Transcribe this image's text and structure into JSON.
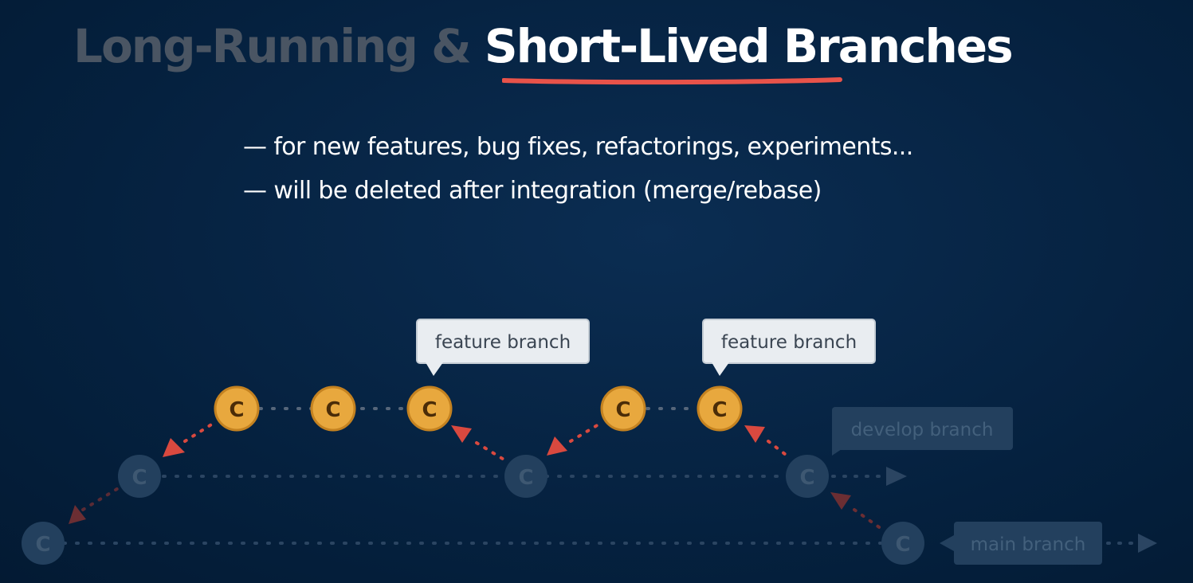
{
  "title": {
    "part_dim": "Long-Running & ",
    "part_bright": "Short-Lived Branches"
  },
  "bullets": [
    "— for new features, bug fixes, refactorings, experiments...",
    "— will be deleted after integration (merge/rebase)"
  ],
  "commit_letter": "C",
  "labels": {
    "feature_1": "feature branch",
    "feature_2": "feature branch",
    "develop": "develop branch",
    "main": "main branch"
  },
  "colors": {
    "background": "#05213f",
    "accent_underline": "#e8534a",
    "feature_commit": "#e8a83e",
    "feature_commit_stroke": "#c48220",
    "dim_commit": "#2a4560",
    "arrow": "#d9493f",
    "label_bright_bg": "#e9edf1",
    "label_dim_bg": "#23405e"
  }
}
